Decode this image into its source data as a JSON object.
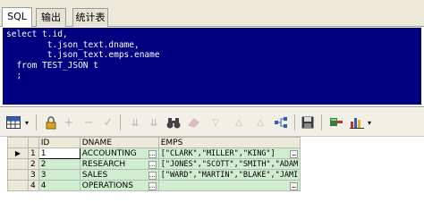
{
  "tabs": [
    {
      "label": "SQL",
      "active": true
    },
    {
      "label": "输出",
      "active": false
    },
    {
      "label": "统计表",
      "active": false
    }
  ],
  "editor": {
    "lines": [
      "select t.id,",
      "        t.json_text.dname,",
      "        t.json_text.emps.ename",
      "  from TEST_JSON t",
      "  ;"
    ]
  },
  "toolbar": {
    "icons": [
      "grid-icon",
      "dropdown-arrow-icon",
      "lock-icon",
      "add-icon",
      "remove-icon",
      "check-icon",
      "double-down-icon",
      "double-down-alt-icon",
      "binoculars-icon",
      "eraser-icon",
      "triangle-down-icon",
      "triangle-up-icon",
      "chart-network-icon",
      "save-icon",
      "connect-icon",
      "bar-chart-icon",
      "dropdown-arrow-icon"
    ]
  },
  "grid": {
    "columns": [
      "",
      "",
      "ID",
      "DNAME",
      "EMPS"
    ],
    "rows": [
      {
        "selected": true,
        "num": "1",
        "id": "1",
        "dname": "ACCOUNTING",
        "emps": "[\"CLARK\",\"MILLER\",\"KING\"]"
      },
      {
        "selected": false,
        "num": "2",
        "id": "2",
        "dname": "RESEARCH",
        "emps": "[\"JONES\",\"SCOTT\",\"SMITH\",\"ADAM"
      },
      {
        "selected": false,
        "num": "3",
        "id": "3",
        "dname": "SALES",
        "emps": "[\"WARD\",\"MARTIN\",\"BLAKE\",\"JAMI"
      },
      {
        "selected": false,
        "num": "4",
        "id": "4",
        "dname": "OPERATIONS",
        "emps": ""
      }
    ],
    "ellipsis": "…"
  }
}
